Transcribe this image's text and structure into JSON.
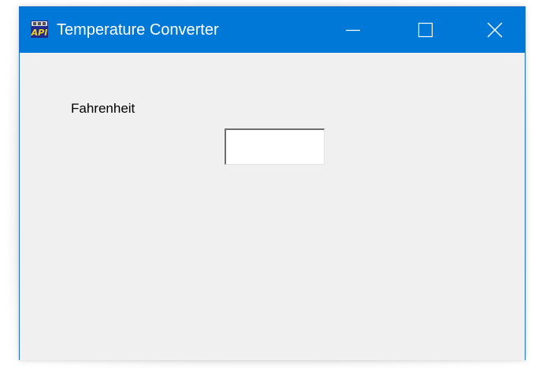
{
  "window": {
    "title": "Temperature Converter",
    "icon": "app-api-icon",
    "controls": {
      "minimize": "minimize-icon",
      "maximize": "maximize-icon",
      "close": "close-icon"
    }
  },
  "form": {
    "fahrenheit_label": "Fahrenheit",
    "fahrenheit_value": ""
  },
  "colors": {
    "titlebar": "#0078d7",
    "client_background": "#f0f0f0"
  }
}
